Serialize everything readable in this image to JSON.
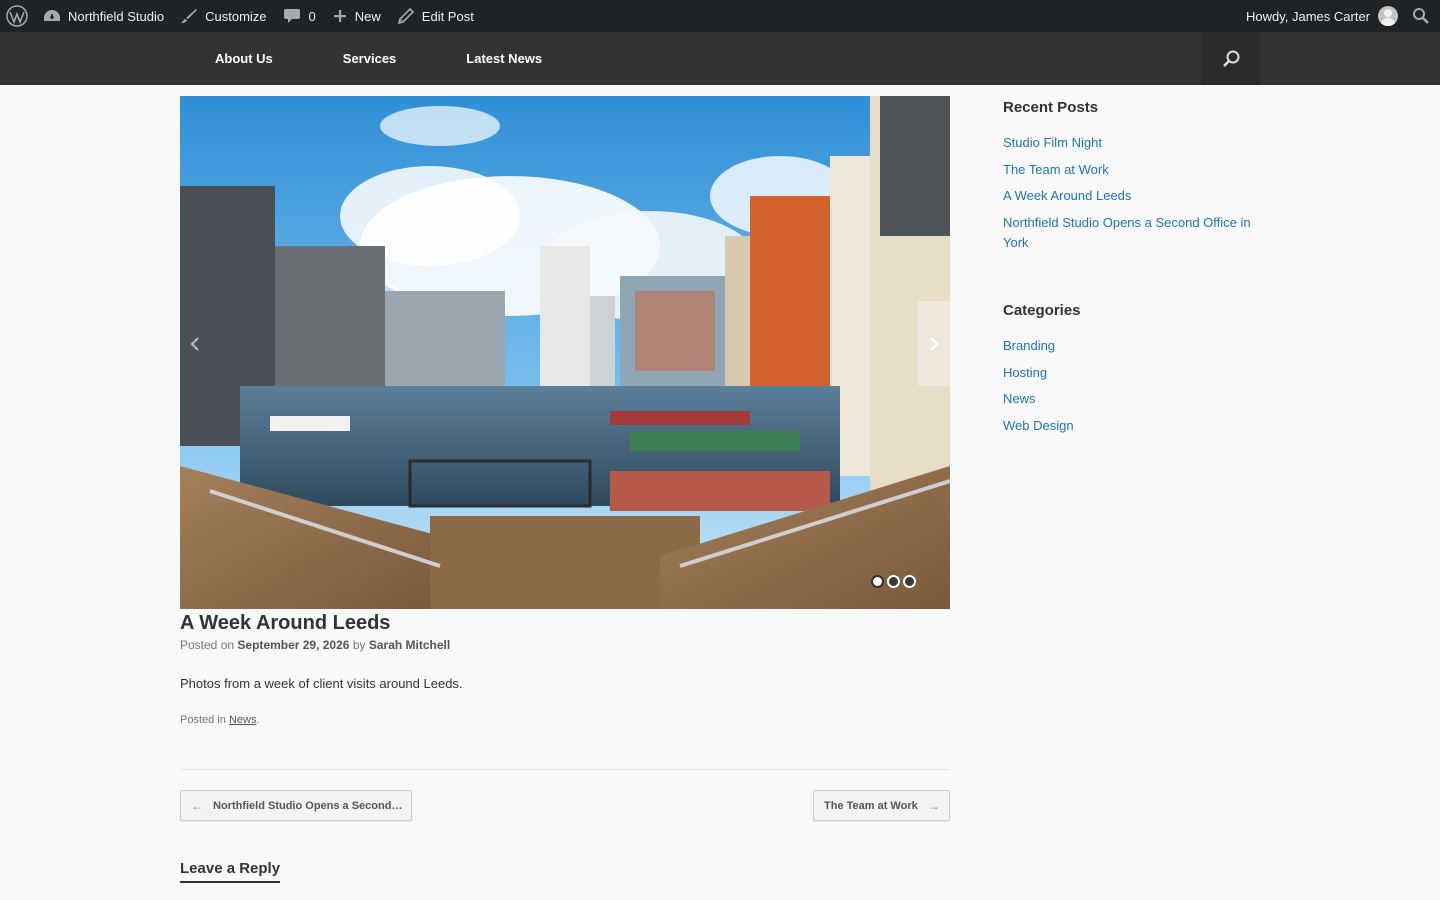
{
  "adminbar": {
    "site_name": "Northfield Studio",
    "customize": "Customize",
    "comments_count": "0",
    "new_label": "New",
    "edit_post": "Edit Post",
    "howdy": "Howdy, James Carter"
  },
  "nav": {
    "items": [
      {
        "label": "About Us"
      },
      {
        "label": "Services"
      },
      {
        "label": "Latest News"
      }
    ]
  },
  "slider": {
    "slide_count": 3,
    "active_slide": 1
  },
  "post": {
    "title": "A Week Around Leeds",
    "posted_on_label": "Posted on",
    "date": "September 29, 2026",
    "by_label": "by",
    "author": "Sarah Mitchell",
    "excerpt": "Photos from a week of client visits around Leeds.",
    "posted_in_label": "Posted in",
    "category": "News",
    "category_suffix": "."
  },
  "post_nav": {
    "prev_arrow": "←",
    "prev_label": "Northfield Studio Opens a Second…",
    "next_label": "The Team at Work",
    "next_arrow": "→"
  },
  "reply": {
    "title": "Leave a Reply"
  },
  "sidebar": {
    "recent_posts_title": "Recent Posts",
    "recent_posts": [
      "Studio Film Night",
      "The Team at Work",
      "A Week Around Leeds",
      "Northfield Studio Opens a Second Office in York"
    ],
    "categories_title": "Categories",
    "categories": [
      "Branding",
      "Hosting",
      "News",
      "Web Design"
    ]
  },
  "colors": {
    "adminbar_bg": "#1d2327",
    "nav_bg": "#333333",
    "link": "#1e73be"
  }
}
